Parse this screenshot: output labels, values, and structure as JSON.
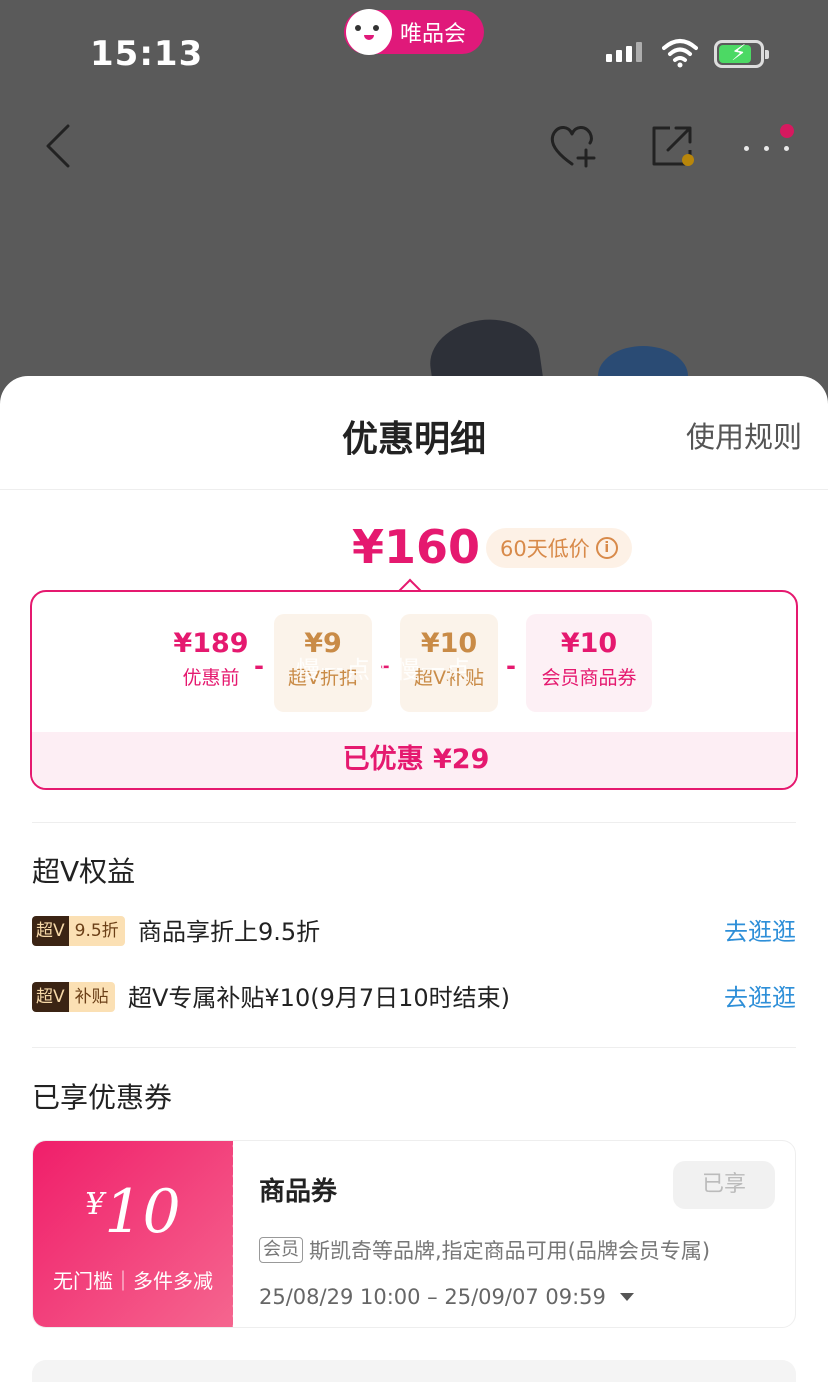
{
  "status_bar": {
    "time": "15:13",
    "app_name": "唯品会"
  },
  "nav": {
    "icons": [
      "back-icon",
      "favorite-icon",
      "share-icon",
      "more-icon"
    ]
  },
  "sheet": {
    "title": "优惠明细",
    "rules_link": "使用规则",
    "price": "¥160",
    "low_price_badge": "60天低价",
    "calc": {
      "items": [
        {
          "value": "¥189",
          "label": "优惠前"
        },
        {
          "value": "¥9",
          "label": "超V折扣"
        },
        {
          "value": "¥10",
          "label": "超V补贴"
        },
        {
          "value": "¥10",
          "label": "会员商品券"
        }
      ],
      "operator": "-",
      "watermark": "慢一点再慢一点",
      "saved": "已优惠 ¥29"
    },
    "benefits": {
      "title": "超V权益",
      "rows": [
        {
          "tag_dark": "超V",
          "tag_light": "9.5折",
          "text": "商品享折上9.5折",
          "link": "去逛逛"
        },
        {
          "tag_dark": "超V",
          "tag_light": "补贴",
          "text": "超V专属补贴¥10(9月7日10时结束)",
          "link": "去逛逛"
        }
      ]
    },
    "coupons": {
      "title": "已享优惠券",
      "items": [
        {
          "currency": "¥",
          "amount": "10",
          "condition": "无门槛｜多件多减",
          "name": "商品券",
          "status": "已享",
          "member_tag": "会员",
          "description": "斯凯奇等品牌,指定商品可用(品牌会员专属)",
          "validity": "25/08/29 10:00 – 25/09/07 09:59"
        }
      ]
    }
  },
  "colors": {
    "brand_pink": "#e5196f",
    "gold": "#c98b47",
    "link_blue": "#2e8fd8"
  }
}
